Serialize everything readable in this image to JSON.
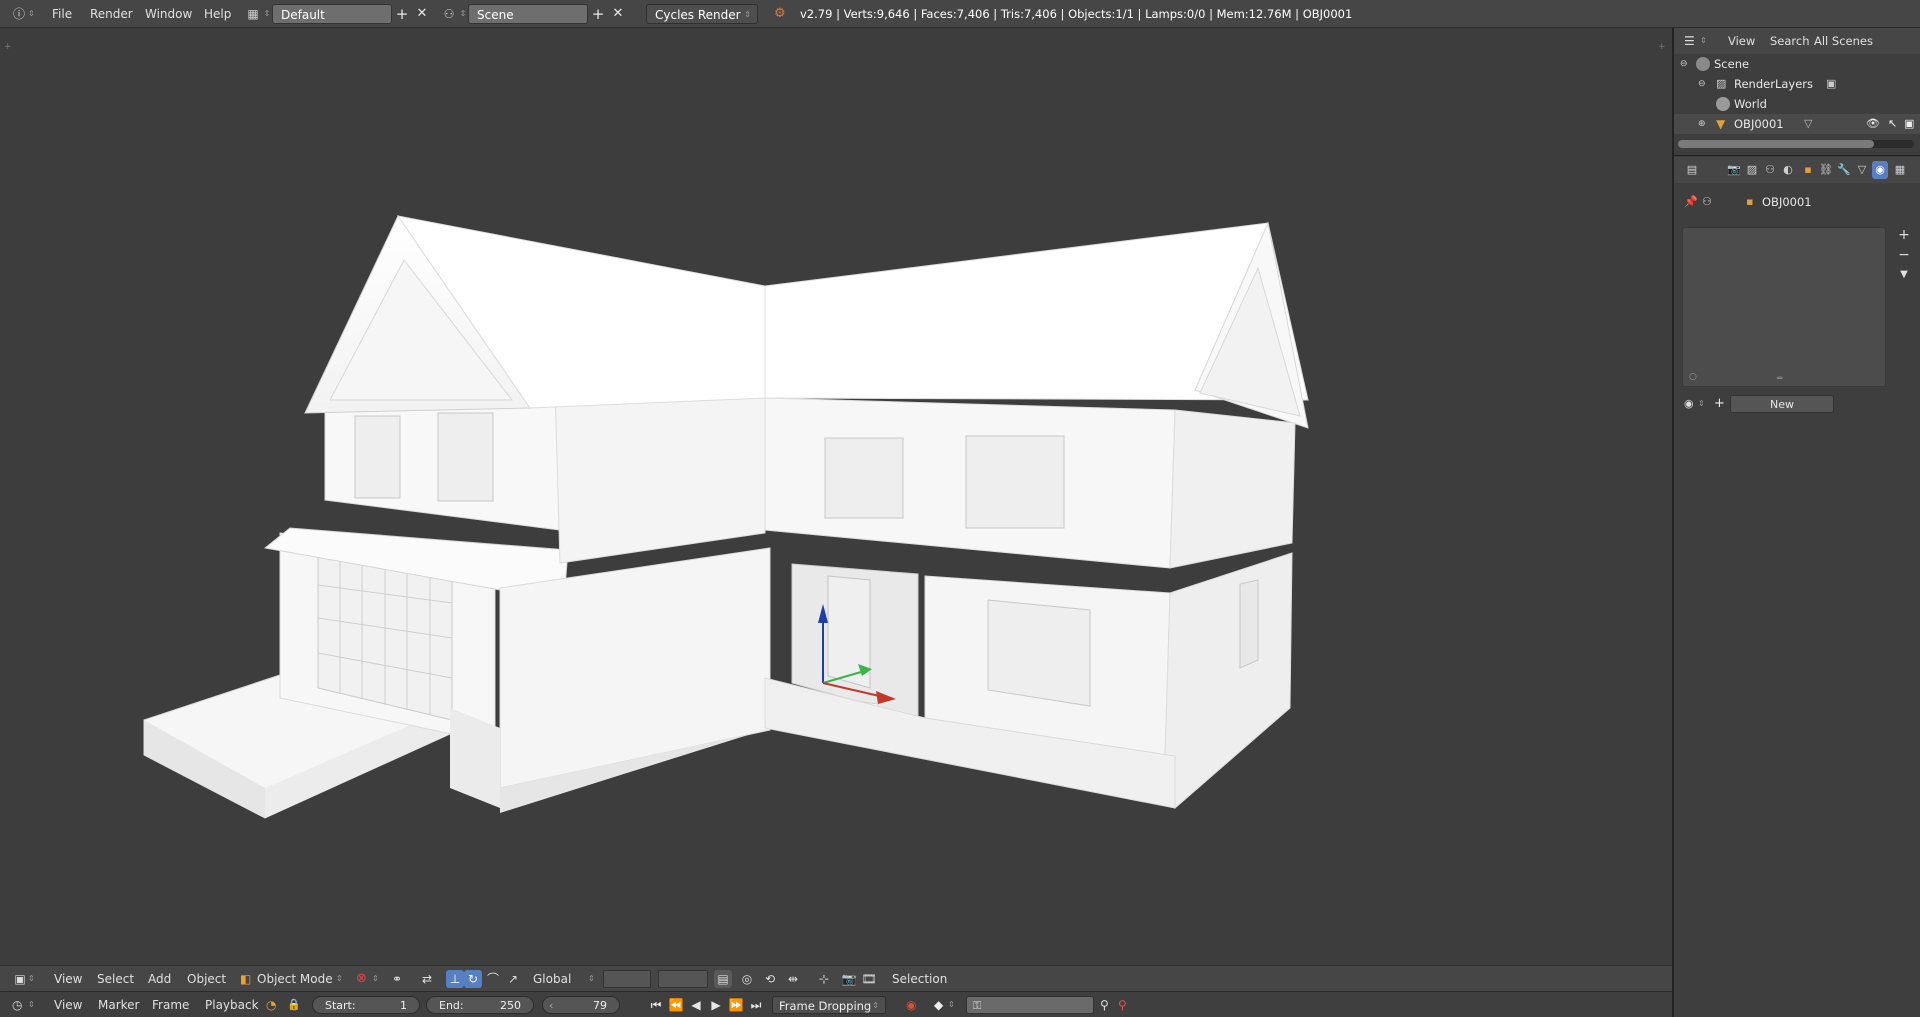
{
  "topbar": {
    "menus": [
      "File",
      "Render",
      "Window",
      "Help"
    ],
    "screen_layout": "Default",
    "scene": "Scene",
    "render_engine": "Cycles Render",
    "stats": "v2.79 | Verts:9,646 | Faces:7,406 | Tris:7,406 | Objects:1/1 | Lamps:0/0 | Mem:12.76M | OBJ0001"
  },
  "view_header": {
    "menus": [
      "View",
      "Select",
      "Add",
      "Object"
    ],
    "mode": "Object Mode",
    "orientation": "Global",
    "status": "Selection"
  },
  "timeline": {
    "menus": [
      "View",
      "Marker",
      "Frame",
      "Playback"
    ],
    "start_label": "Start:",
    "start_value": "1",
    "end_label": "End:",
    "end_value": "250",
    "current_frame": "79",
    "sync_mode": "Frame Dropping"
  },
  "outliner": {
    "tabs": [
      "View",
      "Search",
      "All Scenes"
    ],
    "rows": [
      "Scene",
      "RenderLayers",
      "World",
      "OBJ0001"
    ]
  },
  "properties": {
    "context_object": "OBJ0001",
    "new_button": "New"
  },
  "colors": {
    "accent": "#5680c2",
    "background": "#3d3d3d",
    "axis_x": "#c0392b",
    "axis_y": "#39b54a",
    "axis_z": "#1f3ea8"
  },
  "icons": {
    "info": "info-icon",
    "layout": "screen-layout-icon",
    "scene": "scene-icon",
    "blender": "blender-logo-icon",
    "view3d": "3d-view-icon",
    "timeline": "timeline-icon",
    "outliner": "outliner-icon",
    "properties": "properties-icon"
  }
}
